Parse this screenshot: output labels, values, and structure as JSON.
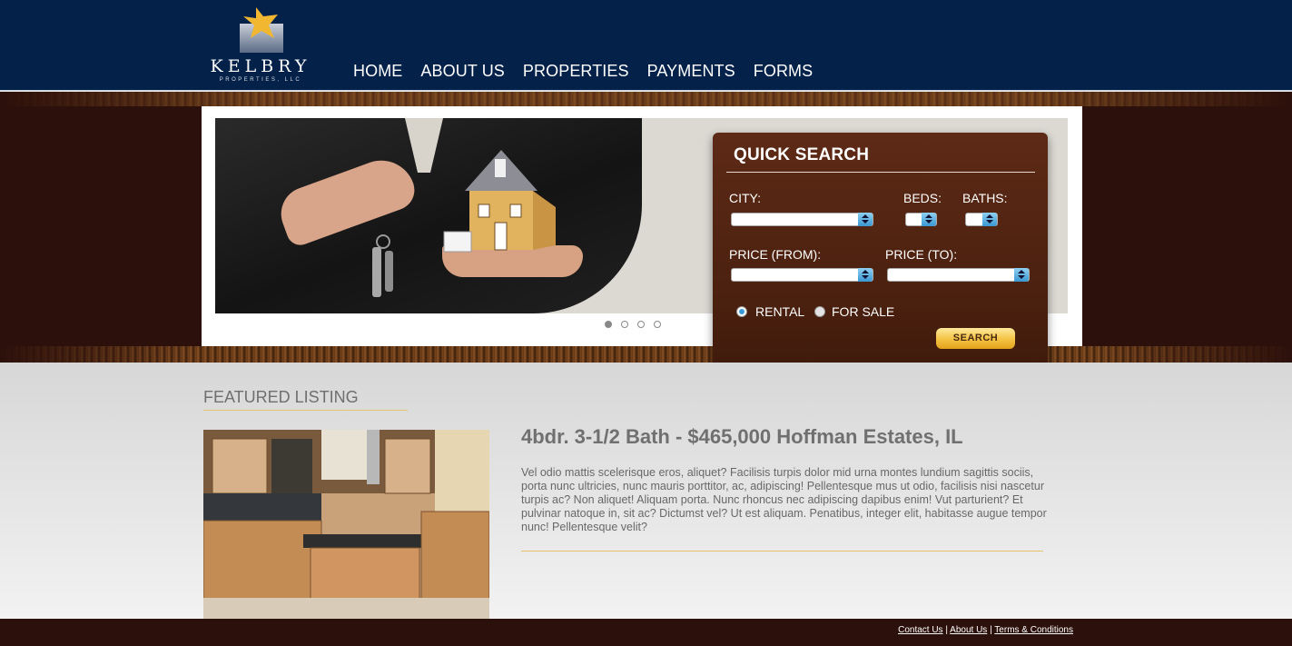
{
  "brand": {
    "name": "KELBRY",
    "subtitle": "PROPERTIES, LLC"
  },
  "nav": [
    "HOME",
    "ABOUT US",
    "PROPERTIES",
    "PAYMENTS",
    "FORMS"
  ],
  "slider": {
    "dot_count": 4,
    "active_dot": 0
  },
  "quick_search": {
    "title": "QUICK SEARCH",
    "city_label": "CITY:",
    "beds_label": "BEDS:",
    "baths_label": "BATHS:",
    "price_from_label": "PRICE (FROM):",
    "price_to_label": "PRICE (TO):",
    "rental_label": "RENTAL",
    "for_sale_label": "FOR SALE",
    "selected_type": "RENTAL",
    "search_button": "SEARCH"
  },
  "featured": {
    "heading": "FEATURED LISTING",
    "title": "4bdr. 3-1/2 Bath - $465,000 Hoffman Estates, IL",
    "description": "Vel odio mattis scelerisque eros, aliquet? Facilisis turpis dolor mid urna montes lundium sagittis sociis, porta nunc ultricies, nunc mauris porttitor, ac, adipiscing! Pellentesque mus ut odio, facilisis nisi nascetur turpis ac? Non aliquet! Aliquam porta. Nunc rhoncus nec adipiscing dapibus enim! Vut parturient? Et pulvinar natoque in, sit ac? Dictumst vel? Ut est aliquam. Penatibus, integer elit, habitasse augue tempor nunc! Pellentesque velit?"
  },
  "footer": {
    "contact": "Contact Us",
    "about": "About Us",
    "terms": "Terms & Conditions",
    "separator": " | "
  },
  "colors": {
    "header_bg": "#04214a",
    "band_bg": "#2c100b",
    "panel_bg": "#5d2a16",
    "accent_gold": "#e6c46e"
  }
}
